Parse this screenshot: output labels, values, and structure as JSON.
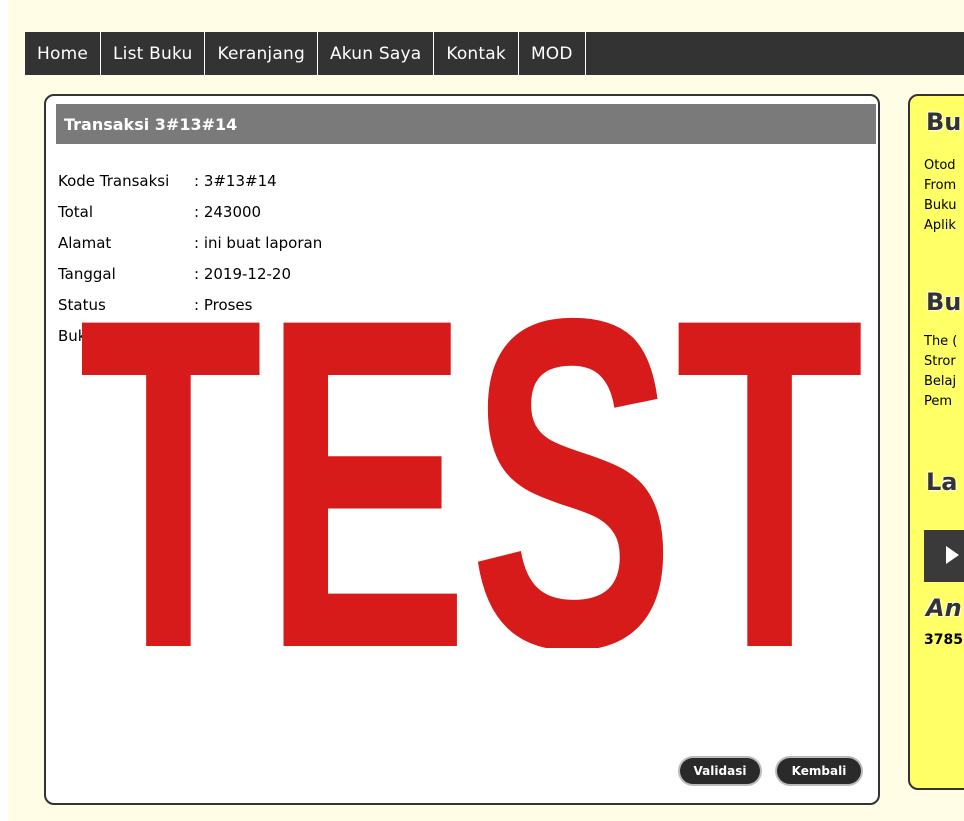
{
  "nav": {
    "items": [
      "Home",
      "List Buku",
      "Keranjang",
      "Akun Saya",
      "Kontak",
      "MOD"
    ]
  },
  "transaction": {
    "header": "Transaksi 3#13#14",
    "fields": [
      {
        "label": "Kode Transaksi",
        "value": ": 3#13#14"
      },
      {
        "label": "Total",
        "value": ": 243000"
      },
      {
        "label": "Alamat",
        "value": ": ini buat laporan"
      },
      {
        "label": "Tanggal",
        "value": ": 2019-12-20"
      },
      {
        "label": "Status",
        "value": ": Proses"
      },
      {
        "label": "Bukti Transaksi",
        "value": ":"
      }
    ],
    "proof_text": "TEST",
    "proof_color": "#d71a1a"
  },
  "buttons": {
    "validasi": "Validasi",
    "kembali": "Kembali"
  },
  "sidebar": {
    "section1_title": "Bu",
    "section1_items": [
      "Otod",
      "From",
      "Buku",
      "Aplik"
    ],
    "section2_title": "Bu",
    "section2_items": [
      "The (",
      "Stror",
      "Belaj",
      "Pem"
    ],
    "section3_title": "La",
    "section4_title": "An",
    "section4_value": "3785"
  },
  "colors": {
    "nav_bg": "#333333",
    "page_bg": "#fffde6",
    "sidebar_bg": "#ffff66",
    "header_bg": "#7a7a7a"
  }
}
